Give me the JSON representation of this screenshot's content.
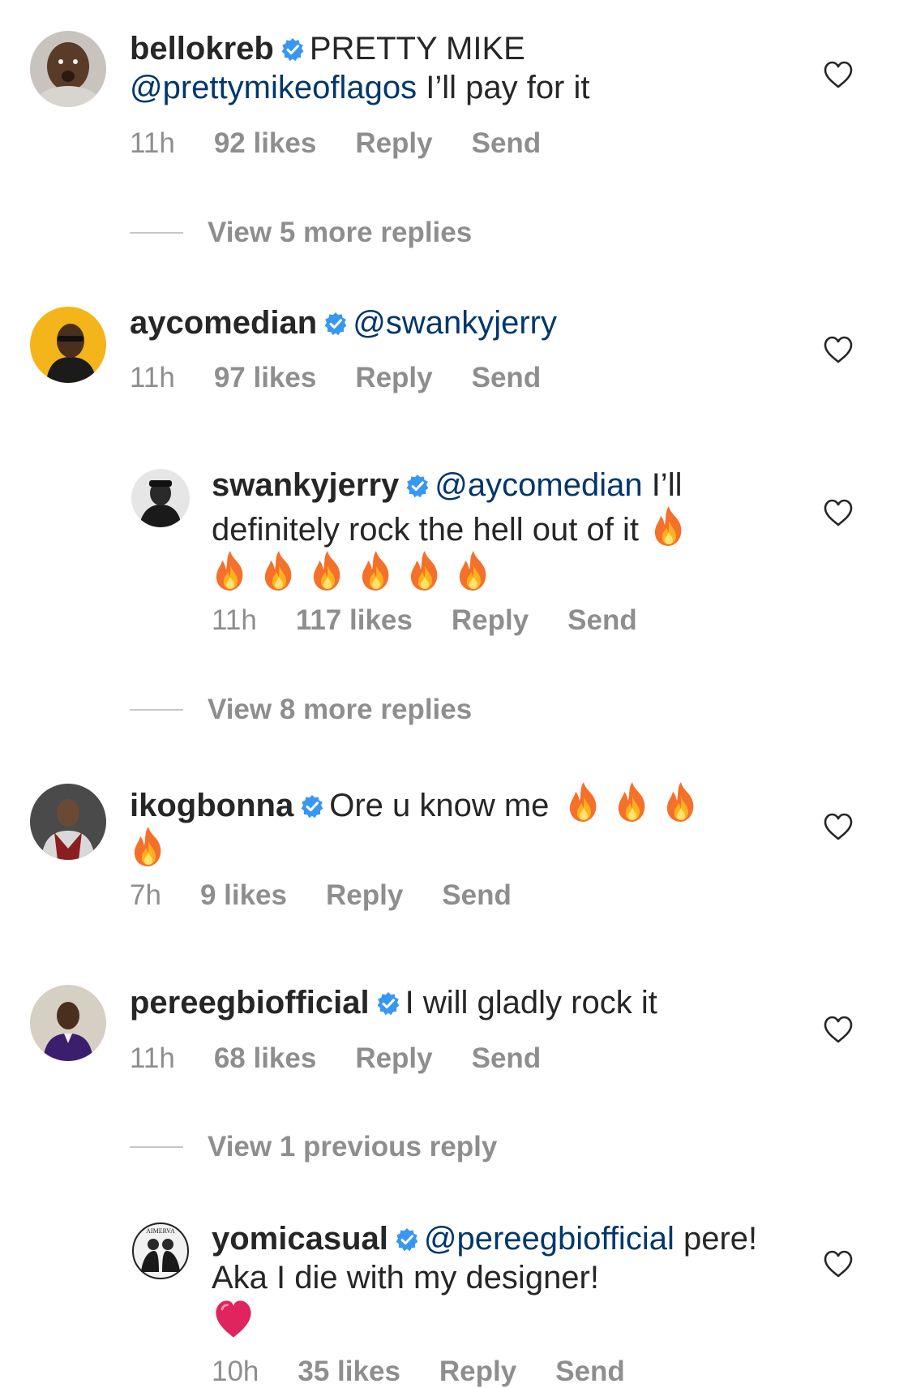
{
  "colors": {
    "verified": "#3897f0",
    "mention": "#00376b",
    "meta": "#8e8e8e",
    "fire": "#f5702a",
    "heart_emoji": "#e0245e"
  },
  "comments": [
    {
      "username": "bellokreb",
      "text_before": "PRETTY MIKE",
      "mention": "@prettymikeoflagos",
      "text_after": " I’ll pay for it",
      "time": "11h",
      "likes": "92 likes",
      "reply": "Reply",
      "send": "Send"
    },
    {
      "username": "aycomedian",
      "mention": "@swankyjerry",
      "time": "11h",
      "likes": "97 likes",
      "reply": "Reply",
      "send": "Send"
    },
    {
      "username": "swankyjerry",
      "mention": "@aycomedian",
      "text_after": " I’ll definitely rock the hell out of it",
      "emojis": [
        "fire",
        "fire",
        "fire",
        "fire",
        "fire",
        "fire",
        "fire"
      ],
      "time": "11h",
      "likes": "117 likes",
      "reply": "Reply",
      "send": "Send"
    },
    {
      "username": "ikogbonna",
      "text_before": "Ore u know me",
      "emojis": [
        "fire",
        "fire",
        "fire",
        "fire"
      ],
      "time": "7h",
      "likes": "9 likes",
      "reply": "Reply",
      "send": "Send"
    },
    {
      "username": "pereegbiofficial",
      "text_before": "I will gladly rock it",
      "time": "11h",
      "likes": "68 likes",
      "reply": "Reply",
      "send": "Send"
    },
    {
      "username": "yomicasual",
      "mention": "@pereegbiofficial",
      "text_after": " pere! Aka I die with my designer!",
      "emojis": [
        "red-heart"
      ],
      "time": "10h",
      "likes": "35 likes",
      "reply": "Reply",
      "send": "Send"
    }
  ],
  "view_replies": [
    "View 5 more replies",
    "View 8 more replies",
    "View 1 previous reply"
  ],
  "avatar_texts": {
    "yomicasual": "AIMERVA"
  }
}
